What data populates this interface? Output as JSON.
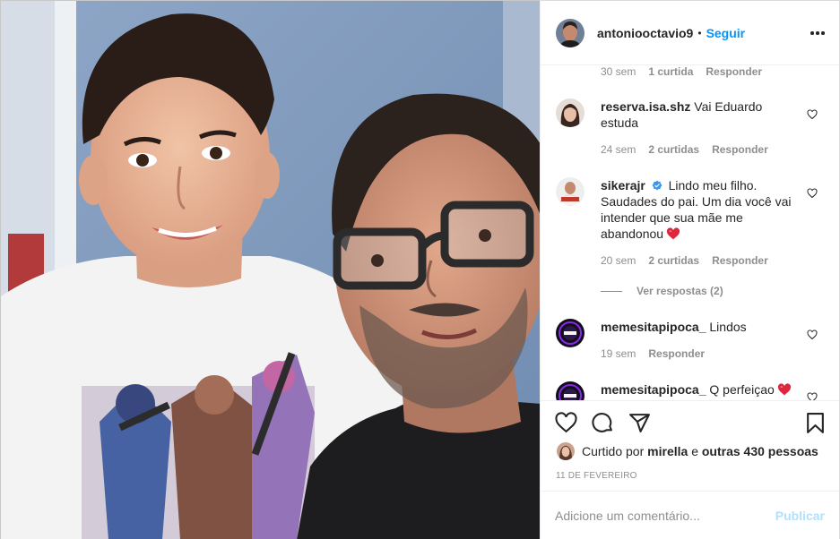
{
  "post": {
    "username": "antoniooctavio9",
    "separator": "•",
    "follow_label": "Seguir",
    "more_icon": "more-options-icon"
  },
  "comments": [
    {
      "id": "c0",
      "time": "30 sem",
      "likes": "1 curtida",
      "reply": "Responder"
    },
    {
      "id": "c1",
      "user": "reserva.isa.shz",
      "text": "Vai Eduardo estuda",
      "time": "24 sem",
      "likes": "2 curtidas",
      "reply": "Responder"
    },
    {
      "id": "c2",
      "user": "sikerajr",
      "verified": true,
      "text": "Lindo meu filho. Saudades do pai. Um dia você vai intender que sua mãe me abandonou",
      "emoji": "red-heart",
      "time": "20 sem",
      "likes": "2 curtidas",
      "reply": "Responder",
      "view_replies": "Ver respostas (2)"
    },
    {
      "id": "c3",
      "user": "memesitapipoca_",
      "text": "Lindos",
      "time": "19 sem",
      "reply": "Responder"
    },
    {
      "id": "c4",
      "user": "memesitapipoca_",
      "text": "Q perfeiçao",
      "emoji": "red-heart"
    }
  ],
  "actions": {
    "like_icon": "heart-icon",
    "comment_icon": "comment-icon",
    "share_icon": "share-icon",
    "save_icon": "bookmark-icon",
    "liked_by_prefix": "Curtido por",
    "liked_by_user": "mirella",
    "liked_by_and": "e",
    "liked_by_others": "outras 430 pessoas",
    "date": "11 DE FEVEREIRO"
  },
  "add_comment": {
    "placeholder": "Adicione um comentário...",
    "post_label": "Publicar"
  },
  "colors": {
    "accent": "#0095f6",
    "post_disabled": "#b2dffc",
    "muted": "#8e8e8e",
    "heart": "#ed4956"
  }
}
